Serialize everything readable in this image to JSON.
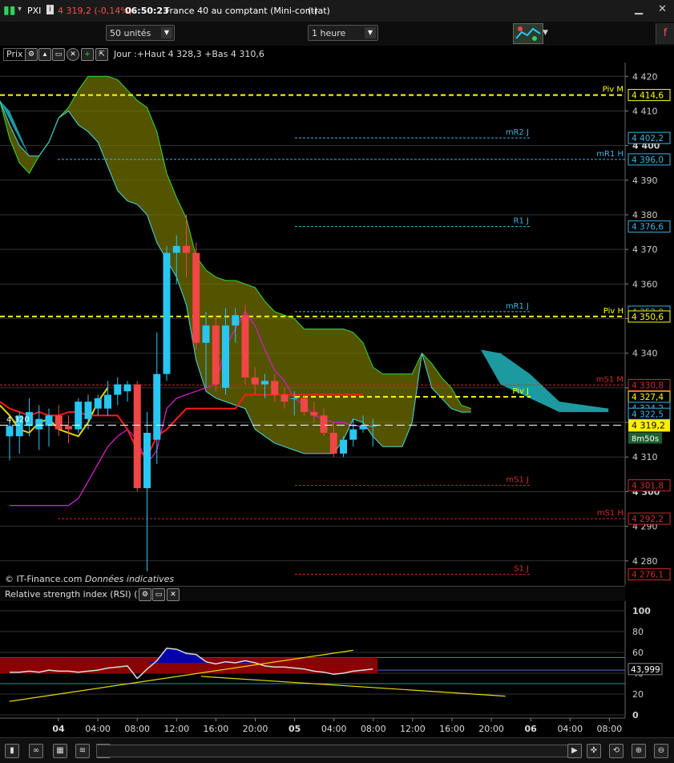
{
  "window": {
    "symbol": "PXI",
    "price_change": "4 319,2 (-0,14%)",
    "time": "06:50:23",
    "instrument": "France 40 au comptant (Mini-contrat)",
    "instrument_suffix": "(-)"
  },
  "toolbar": {
    "units_select": "50 unités",
    "period_select": "1 heure"
  },
  "chart_header": {
    "panel_label": "Prix",
    "info": "Jour :+Haut 4 328,3 +Bas 4 310,6"
  },
  "footer_note": {
    "brand": "© IT-Finance.com",
    "note": "Données indicatives"
  },
  "rsi_header": {
    "label": "Relative strength index (RSI) (14)"
  },
  "colors": {
    "bull": "#29c6f2",
    "bear": "#f04646",
    "cloud_bull": "#808000",
    "cloud_bear": "#1d9aa0",
    "pivot": "#ffff00",
    "resistance": "#3ab4e6",
    "support": "#d02a2a",
    "rsi_band": "#8b0000",
    "rsi_fill": "#0000b0"
  },
  "chart_data": [
    {
      "type": "candlestick",
      "title": "",
      "ylim": [
        4273,
        4424
      ],
      "y_ticks": [
        "4 420",
        "4 410",
        "4 400",
        "4 390",
        "4 380",
        "4 370",
        "4 360",
        "4 350",
        "4 340",
        "4 330",
        "4 320",
        "4 310",
        "4 300",
        "4 290",
        "4 280"
      ],
      "x_ticks": [
        "04",
        "04:00",
        "08:00",
        "12:00",
        "16:00",
        "20:00",
        "05",
        "04:00",
        "08:00",
        "12:00",
        "16:00",
        "20:00",
        "06",
        "04:00",
        "08:00"
      ],
      "candles": [
        {
          "o": 4316,
          "h": 4322,
          "l": 4309,
          "c": 4319
        },
        {
          "o": 4316,
          "h": 4323,
          "l": 4311,
          "c": 4322
        },
        {
          "o": 4319,
          "h": 4327,
          "l": 4316,
          "c": 4323
        },
        {
          "o": 4318,
          "h": 4325,
          "l": 4312,
          "c": 4321
        },
        {
          "o": 4319,
          "h": 4324,
          "l": 4313,
          "c": 4322
        },
        {
          "o": 4322,
          "h": 4325,
          "l": 4316,
          "c": 4318
        },
        {
          "o": 4319,
          "h": 4322,
          "l": 4314,
          "c": 4318
        },
        {
          "o": 4318,
          "h": 4327,
          "l": 4317,
          "c": 4326
        },
        {
          "o": 4321,
          "h": 4328,
          "l": 4318,
          "c": 4326
        },
        {
          "o": 4324,
          "h": 4328,
          "l": 4322,
          "c": 4327
        },
        {
          "o": 4324,
          "h": 4332,
          "l": 4322,
          "c": 4328
        },
        {
          "o": 4328,
          "h": 4333,
          "l": 4325,
          "c": 4331
        },
        {
          "o": 4329,
          "h": 4332,
          "l": 4326,
          "c": 4331
        },
        {
          "o": 4331,
          "h": 4332,
          "l": 4300,
          "c": 4301
        },
        {
          "o": 4301,
          "h": 4323,
          "l": 4277,
          "c": 4317
        },
        {
          "o": 4315,
          "h": 4346,
          "l": 4308,
          "c": 4334
        },
        {
          "o": 4334,
          "h": 4371,
          "l": 4332,
          "c": 4369
        },
        {
          "o": 4369,
          "h": 4374,
          "l": 4360,
          "c": 4371
        },
        {
          "o": 4371,
          "h": 4380,
          "l": 4362,
          "c": 4369
        },
        {
          "o": 4369,
          "h": 4372,
          "l": 4341,
          "c": 4343
        },
        {
          "o": 4343,
          "h": 4352,
          "l": 4330,
          "c": 4348
        },
        {
          "o": 4348,
          "h": 4351,
          "l": 4329,
          "c": 4331
        },
        {
          "o": 4330,
          "h": 4353,
          "l": 4328,
          "c": 4348
        },
        {
          "o": 4348,
          "h": 4353,
          "l": 4343,
          "c": 4351
        },
        {
          "o": 4351,
          "h": 4354,
          "l": 4331,
          "c": 4333
        },
        {
          "o": 4333,
          "h": 4336,
          "l": 4328,
          "c": 4331
        },
        {
          "o": 4331,
          "h": 4334,
          "l": 4327,
          "c": 4332
        },
        {
          "o": 4332,
          "h": 4334,
          "l": 4326,
          "c": 4328
        },
        {
          "o": 4328,
          "h": 4330,
          "l": 4324,
          "c": 4326
        },
        {
          "o": 4327,
          "h": 4329,
          "l": 4322,
          "c": 4327
        },
        {
          "o": 4327,
          "h": 4328,
          "l": 4322,
          "c": 4323
        },
        {
          "o": 4323,
          "h": 4326,
          "l": 4320,
          "c": 4322
        },
        {
          "o": 4322,
          "h": 4324,
          "l": 4316,
          "c": 4317
        },
        {
          "o": 4317,
          "h": 4320,
          "l": 4310,
          "c": 4311
        },
        {
          "o": 4311,
          "h": 4316,
          "l": 4310,
          "c": 4315
        },
        {
          "o": 4315,
          "h": 4321,
          "l": 4313,
          "c": 4318
        },
        {
          "o": 4318,
          "h": 4322,
          "l": 4317,
          "c": 4319
        },
        {
          "o": 4319,
          "h": 4321,
          "l": 4313,
          "c": 4319
        }
      ],
      "levels": [
        {
          "name": "Piv M",
          "value": 4414.6,
          "label": "4 414,6",
          "kind": "pivot",
          "span": "full"
        },
        {
          "name": "mR2 J",
          "value": 4402.2,
          "label": "4 402,2",
          "kind": "resistance",
          "span": "day"
        },
        {
          "name": "mR1 H",
          "value": 4396.0,
          "label": "4 396,0",
          "kind": "resistance",
          "span": "week"
        },
        {
          "name": "R1 J",
          "value": 4376.6,
          "label": "4 376,6",
          "kind": "resistance",
          "span": "day"
        },
        {
          "name": "mR1 J",
          "value": 4352.0,
          "label": "4 352,0",
          "kind": "resistance",
          "span": "day"
        },
        {
          "name": "Piv H",
          "value": 4350.6,
          "label": "4 350,6",
          "kind": "pivot",
          "span": "full"
        },
        {
          "name": "mS1 M",
          "value": 4330.8,
          "label": "4 330,8",
          "kind": "support",
          "span": "full"
        },
        {
          "name": "Piv J",
          "value": 4327.4,
          "label": "4 327,4",
          "kind": "pivot",
          "span": "day"
        },
        {
          "name": "",
          "value": 4324.2,
          "label": "4 324,2",
          "kind": "resistance",
          "span": "none"
        },
        {
          "name": "",
          "value": 4322.5,
          "label": "4 322,5",
          "kind": "resistance",
          "span": "none"
        },
        {
          "name": "mS1 J",
          "value": 4301.8,
          "label": "4 301,8",
          "kind": "support",
          "span": "day"
        },
        {
          "name": "mS1 H",
          "value": 4292.2,
          "label": "4 292,2",
          "kind": "support",
          "span": "week"
        },
        {
          "name": "S1 J",
          "value": 4276.1,
          "label": "4 276,1",
          "kind": "support",
          "span": "day"
        }
      ],
      "current_price": {
        "value": 4319.2,
        "label": "4 319,2",
        "countdown": "8m50s",
        "line_label": "4 320"
      },
      "cloud_top": [
        4413,
        4402,
        4395,
        4392,
        4397,
        4401,
        4408,
        4411,
        4416,
        4420,
        4420,
        4420,
        4419,
        4416,
        4413,
        4411,
        4404,
        4392,
        4385,
        4379,
        4368,
        4364,
        4362,
        4361,
        4361,
        4360,
        4359,
        4355,
        4352,
        4351,
        4350,
        4347,
        4347,
        4347,
        4347,
        4347,
        4346,
        4343,
        4336,
        4334,
        4334,
        4334,
        4334,
        4340,
        4337,
        4333,
        4330,
        4325,
        4324
      ],
      "cloud_bottom": [
        4413,
        4406,
        4400,
        4397,
        4397,
        4401,
        4408,
        4410,
        4406,
        4404,
        4401,
        4394,
        4387,
        4384,
        4383,
        4380,
        4372,
        4367,
        4362,
        4354,
        4338,
        4329,
        4327,
        4326,
        4325,
        4324,
        4318,
        4316,
        4314,
        4313,
        4312,
        4311,
        4311,
        4311,
        4311,
        4315,
        4321,
        4320,
        4316,
        4313,
        4313,
        4313,
        4320,
        4340,
        4330,
        4327,
        4324,
        4323,
        4323
      ],
      "ma_red": [
        4326,
        4324,
        4323,
        4322,
        4323,
        4322,
        4322,
        4323,
        4323,
        4322,
        4322,
        4322,
        4322,
        4318,
        4312,
        4310,
        4316,
        4318,
        4321,
        4324,
        4324,
        4324,
        4324,
        4324,
        4324,
        4328,
        4328,
        4328,
        4328,
        4328,
        4328,
        4328,
        4328,
        4328,
        4328,
        4328,
        4328,
        4328
      ],
      "ma_yellow": [
        4325,
        4322,
        4318,
        4317,
        4320,
        4321,
        4318,
        4317,
        4316,
        4320,
        4326,
        4330
      ],
      "ma_magenta": [
        4296,
        4296,
        4296,
        4296,
        4296,
        4296,
        4296,
        4298,
        4303,
        4308,
        4313,
        4316,
        4318,
        4315,
        4308,
        4312,
        4324,
        4327,
        4328,
        4329,
        4330,
        4331,
        4342,
        4347,
        4352,
        4348,
        4341,
        4335,
        4332,
        4327,
        4325,
        4322,
        4321,
        4320,
        4320,
        4319,
        4319,
        4319
      ]
    },
    {
      "type": "line",
      "title": "Relative strength index (RSI) (14)",
      "ylim": [
        0,
        100
      ],
      "y_ticks": [
        "100",
        "80",
        "60",
        "40",
        "20",
        "0"
      ],
      "current": {
        "value": 43.999,
        "label": "43,999"
      },
      "band": [
        40,
        55
      ],
      "values": [
        41,
        41,
        42,
        41,
        43,
        42,
        42,
        41,
        42,
        43,
        45,
        46,
        47,
        35,
        44,
        52,
        64,
        63,
        59,
        58,
        51,
        49,
        51,
        50,
        52,
        50,
        47,
        46,
        46,
        45,
        44,
        42,
        41,
        39,
        40,
        42,
        43,
        44
      ],
      "trend_lines": [
        {
          "from": [
            0,
            13
          ],
          "to": [
            70,
            62
          ]
        },
        {
          "from": [
            39,
            37
          ],
          "to": [
            101,
            18
          ]
        }
      ]
    }
  ],
  "bottom_bar": {
    "icons": [
      "candle-style-icon",
      "link-icon",
      "chart-type-icon",
      "indicator-icon",
      "drawing-icon"
    ]
  }
}
